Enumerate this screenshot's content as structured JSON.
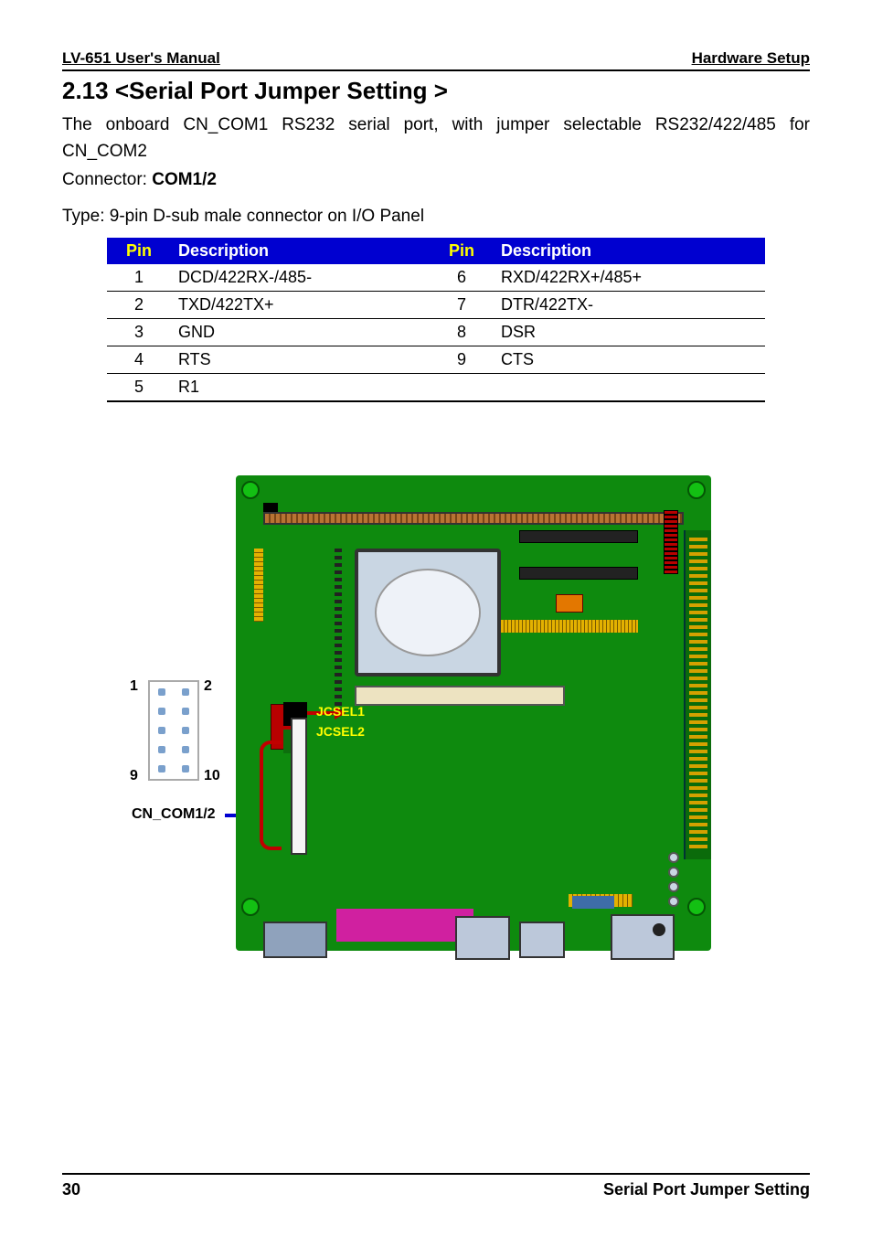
{
  "header": {
    "left": "LV-651 User's Manual",
    "right": "Hardware Setup"
  },
  "section": {
    "title": "2.13 <Serial Port Jumper Setting >"
  },
  "intro": "The onboard CN_COM1 RS232 serial port, with jumper selectable RS232/422/485 for CN_COM2",
  "connector_prefix": "Connector: ",
  "connector_name": "COM1/2",
  "type_line": "Type: 9-pin D-sub male connector on I/O Panel",
  "table": {
    "headers": {
      "pin": "Pin",
      "desc": "Description"
    },
    "rows": [
      {
        "p1": "1",
        "d1": "DCD/422RX-/485-",
        "p2": "6",
        "d2": "RXD/422RX+/485+"
      },
      {
        "p1": "2",
        "d1": "TXD/422TX+",
        "p2": "7",
        "d2": "DTR/422TX-"
      },
      {
        "p1": "3",
        "d1": "GND",
        "p2": "8",
        "d2": "DSR"
      },
      {
        "p1": "4",
        "d1": "RTS",
        "p2": "9",
        "d2": "CTS"
      },
      {
        "p1": "5",
        "d1": "R1",
        "p2": "",
        "d2": ""
      }
    ]
  },
  "diagram": {
    "pin1": "1",
    "pin2": "2",
    "pin9": "9",
    "pin10": "10",
    "cn_com": "CN_COM1/2",
    "jcsel1": "JCSEL1",
    "jcsel2": "JCSEL2"
  },
  "footer": {
    "page": "30",
    "title": "Serial Port Jumper Setting"
  }
}
